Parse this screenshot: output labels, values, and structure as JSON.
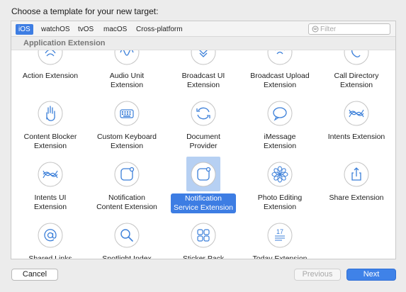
{
  "dialog": {
    "title": "Choose a template for your new target:"
  },
  "platform_tabs": [
    {
      "label": "iOS",
      "selected": true
    },
    {
      "label": "watchOS",
      "selected": false
    },
    {
      "label": "tvOS",
      "selected": false
    },
    {
      "label": "macOS",
      "selected": false
    },
    {
      "label": "Cross-platform",
      "selected": false
    }
  ],
  "search": {
    "placeholder": "Filter",
    "value": ""
  },
  "section": {
    "title": "Application Extension"
  },
  "templates": [
    {
      "label": "Action Extension",
      "icon": "action-icon",
      "selected": false
    },
    {
      "label": "Audio Unit\nExtension",
      "icon": "audio-unit-icon",
      "selected": false
    },
    {
      "label": "Broadcast UI\nExtension",
      "icon": "broadcast-ui-icon",
      "selected": false
    },
    {
      "label": "Broadcast Upload\nExtension",
      "icon": "broadcast-upload-icon",
      "selected": false
    },
    {
      "label": "Call Directory\nExtension",
      "icon": "call-directory-icon",
      "selected": false
    },
    {
      "label": "Content Blocker\nExtension",
      "icon": "hand-icon",
      "selected": false
    },
    {
      "label": "Custom Keyboard\nExtension",
      "icon": "keyboard-icon",
      "selected": false
    },
    {
      "label": "Document\nProvider",
      "icon": "document-provider-icon",
      "selected": false
    },
    {
      "label": "iMessage\nExtension",
      "icon": "speech-bubble-icon",
      "selected": false
    },
    {
      "label": "Intents Extension",
      "icon": "intents-icon",
      "selected": false
    },
    {
      "label": "Intents UI\nExtension",
      "icon": "intents-ui-icon",
      "selected": false
    },
    {
      "label": "Notification\nContent Extension",
      "icon": "notification-content-icon",
      "selected": false
    },
    {
      "label": "Notification\nService Extension",
      "icon": "notification-service-icon",
      "selected": true
    },
    {
      "label": "Photo Editing\nExtension",
      "icon": "photo-editing-icon",
      "selected": false
    },
    {
      "label": "Share Extension",
      "icon": "share-icon",
      "selected": false
    },
    {
      "label": "Shared Links",
      "icon": "at-sign-icon",
      "selected": false
    },
    {
      "label": "Spotlight Index",
      "icon": "magnifier-icon",
      "selected": false
    },
    {
      "label": "Sticker Pack",
      "icon": "sticker-grid-icon",
      "selected": false
    },
    {
      "label": "Today Extension",
      "icon": "calendar-icon",
      "selected": false
    }
  ],
  "footer": {
    "cancel_label": "Cancel",
    "previous_label": "Previous",
    "next_label": "Next"
  },
  "colors": {
    "accent": "#3d7de3",
    "icon_stroke": "#3b7fd9",
    "selection_bg": "#b6d0f3"
  }
}
